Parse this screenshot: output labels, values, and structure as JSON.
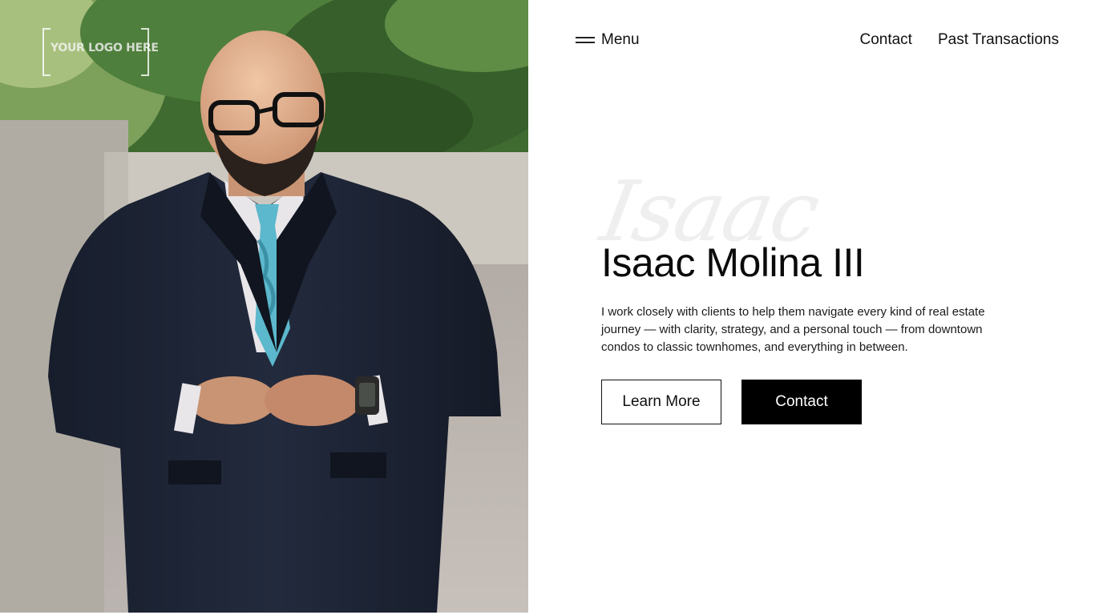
{
  "logo": {
    "text": "YOUR LOGO HERE"
  },
  "nav": {
    "menu_label": "Menu",
    "menu_icon": "hamburger-icon",
    "links": [
      {
        "label": "Contact"
      },
      {
        "label": "Past Transactions"
      }
    ]
  },
  "hero": {
    "script_name": "Isaac",
    "title": "Isaac Molina III",
    "description": "I work closely with clients to help them navigate every kind of real estate journey — with clarity, strategy, and a personal touch — from downtown condos to classic townhomes, and everything in between.",
    "buttons": {
      "learn_more": "Learn More",
      "contact": "Contact"
    }
  },
  "colors": {
    "background": "#ffffff",
    "text": "#111111",
    "primary_button": "#000000",
    "suit": "#1b2233",
    "tie": "#5cb8cc",
    "foliage": "#4c7a3a"
  }
}
